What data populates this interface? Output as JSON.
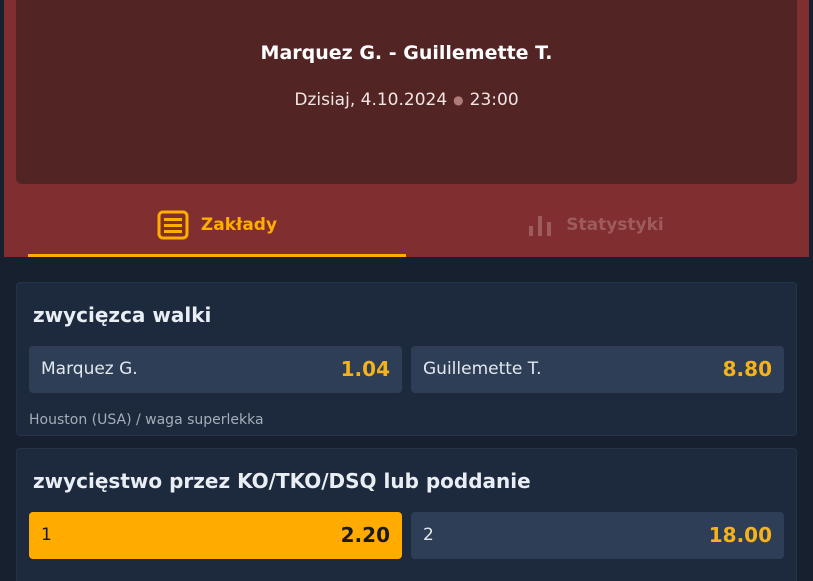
{
  "event": {
    "title": "Marquez G. - Guillemette T.",
    "day": "Dzisiaj, 4.10.2024",
    "time": "23:00"
  },
  "tabs": [
    {
      "label": "Zakłady",
      "icon": "list-icon",
      "active": true
    },
    {
      "label": "Statystyki",
      "icon": "bar-chart-icon",
      "active": false
    }
  ],
  "markets": [
    {
      "title": "zwycięzca walki",
      "selections": [
        {
          "name": "Marquez G.",
          "odds": "1.04"
        },
        {
          "name": "Guillemette T.",
          "odds": "8.80"
        }
      ],
      "info": "Houston (USA) / waga superlekka"
    },
    {
      "title": "zwycięstwo przez KO/TKO/DSQ lub poddanie",
      "selections": [
        {
          "name": "1",
          "odds": "2.20",
          "selected": true
        },
        {
          "name": "2",
          "odds": "18.00"
        }
      ]
    }
  ],
  "colors": {
    "accent": "#ffae00",
    "header_bg": "#802e2f",
    "hero_bg": "#532424",
    "page_bg": "#16202f"
  }
}
